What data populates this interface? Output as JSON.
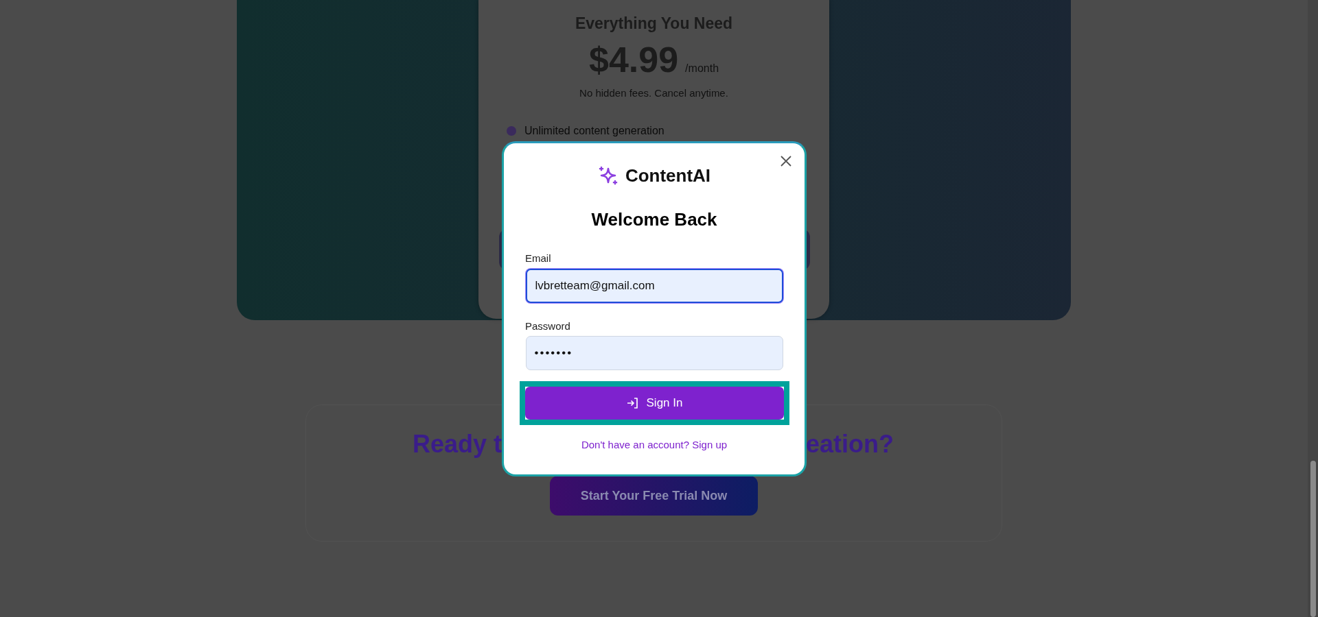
{
  "background": {
    "pricing_card": {
      "title": "Everything You Need",
      "price": "$4.99",
      "period": "/month",
      "note": "No hidden fees. Cancel anytime.",
      "features": [
        "Unlimited content generation"
      ]
    },
    "cta": {
      "heading_left": "Ready t",
      "heading_right": "eation?",
      "button": "Start Your Free Trial Now"
    }
  },
  "modal": {
    "brand": "ContentAI",
    "title": "Welcome Back",
    "fields": [
      {
        "label": "Email",
        "value": "lvbretteam@gmail.com",
        "kind": "text",
        "focused": true
      },
      {
        "label": "Password",
        "value": "•••••••",
        "kind": "password",
        "focused": false
      }
    ],
    "submit": {
      "label": "Sign In",
      "highlighted": true
    },
    "footer_link": "Don't have an account? Sign up"
  }
}
